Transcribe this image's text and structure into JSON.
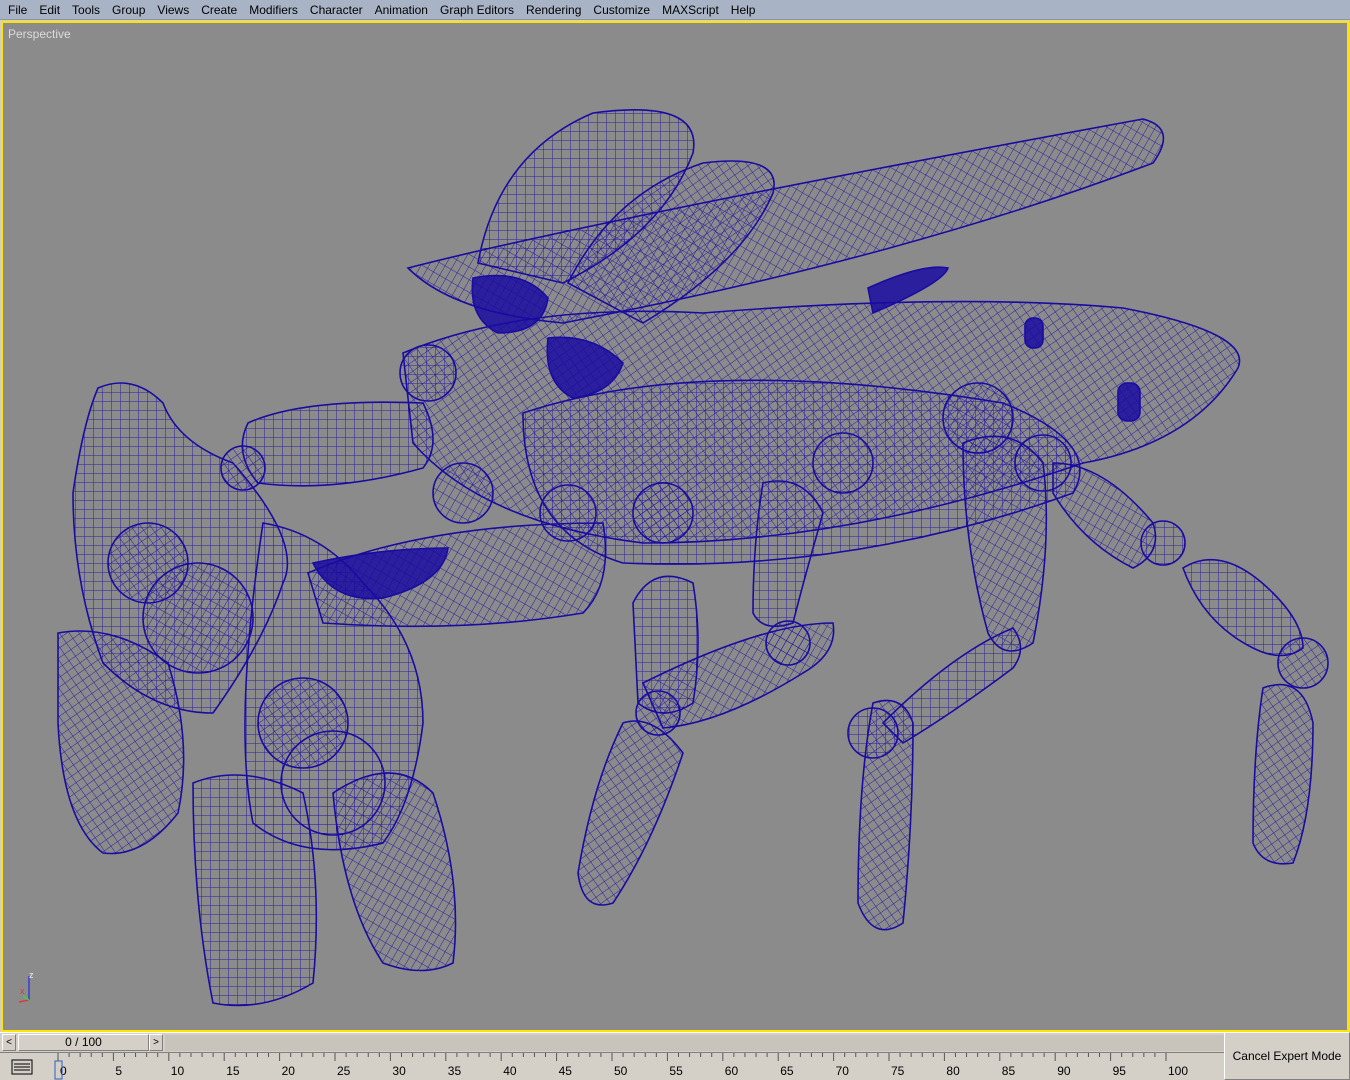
{
  "menu": {
    "items": [
      "File",
      "Edit",
      "Tools",
      "Group",
      "Views",
      "Create",
      "Modifiers",
      "Character",
      "Animation",
      "Graph Editors",
      "Rendering",
      "Customize",
      "MAXScript",
      "Help"
    ]
  },
  "viewport": {
    "label": "Perspective",
    "background_color": "#8b8b8b",
    "active_border_color": "#ffe400",
    "wire_color": "#1a0ca0"
  },
  "axis": {
    "x": "x",
    "z": "z"
  },
  "time_slider": {
    "value": "0 / 100",
    "left_arrow": "<",
    "right_arrow": ">"
  },
  "trackbar": {
    "ticks": [
      "0",
      "5",
      "10",
      "15",
      "20",
      "25",
      "30",
      "35",
      "40",
      "45",
      "50",
      "55",
      "60",
      "65",
      "70",
      "75",
      "80",
      "85",
      "90",
      "95",
      "100"
    ],
    "current_frame": 0
  },
  "cancel_expert": {
    "label": "Cancel Expert Mode"
  }
}
